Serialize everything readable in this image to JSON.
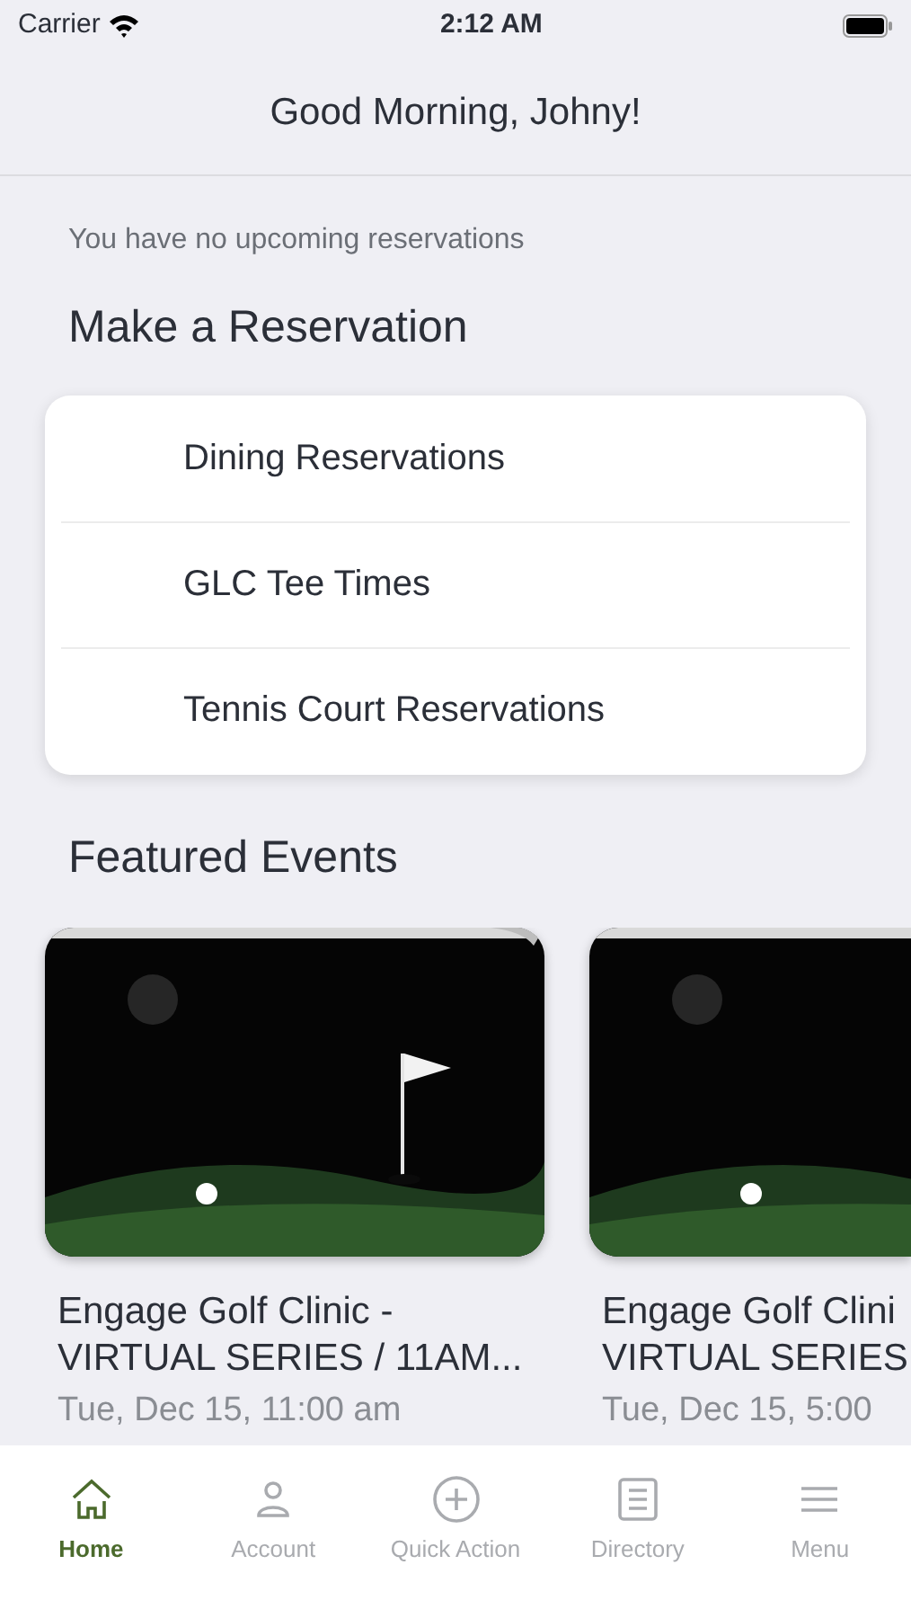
{
  "status_bar": {
    "carrier": "Carrier",
    "time": "2:12 AM"
  },
  "header": {
    "title": "Good Morning, Johny!"
  },
  "notice": "You have no upcoming reservations",
  "reservations": {
    "title": "Make a Reservation",
    "items": [
      {
        "label": "Dining Reservations"
      },
      {
        "label": "GLC Tee Times"
      },
      {
        "label": "Tennis Court Reservations"
      }
    ]
  },
  "featured": {
    "title": "Featured Events",
    "events": [
      {
        "image": {
          "kind": "picture"
        },
        "title_lines": [
          "Engage Golf Clinic -",
          "VIRTUAL SERIES / 11AM..."
        ],
        "date": "Tue, Dec 15, 11:00 am"
      },
      {
        "image": {
          "kind": "picture"
        },
        "title_lines": [
          "Engage Golf Clini",
          "VIRTUAL SERIES"
        ],
        "date": "Tue, Dec 15, 5:00"
      }
    ]
  },
  "tab_bar": [
    {
      "label": "Home",
      "kind": "home",
      "selected": true
    },
    {
      "label": "Account",
      "kind": "user",
      "selected": false
    },
    {
      "label": "Quick Action",
      "kind": "plus",
      "selected": false
    },
    {
      "label": "Directory",
      "kind": "list",
      "selected": false
    },
    {
      "label": "Menu",
      "kind": "menu",
      "selected": false
    }
  ]
}
